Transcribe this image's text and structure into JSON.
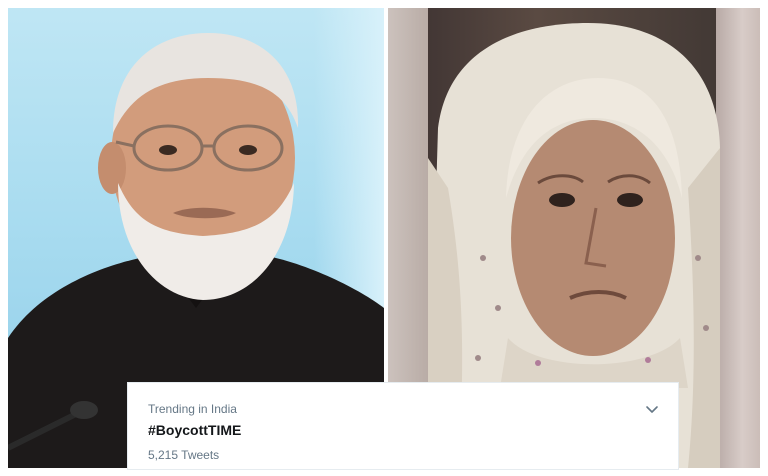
{
  "photos": {
    "left": {
      "icon": "portrait-man-icon"
    },
    "right": {
      "icon": "portrait-woman-icon"
    }
  },
  "trend": {
    "context": "Trending in India",
    "hashtag": "#BoycottTIME",
    "count": "5,215 Tweets",
    "menu_icon": "chevron-down-icon"
  },
  "colors": {
    "secondary_text": "#657786",
    "primary_text": "#14171a",
    "border": "#e6ecf0"
  }
}
